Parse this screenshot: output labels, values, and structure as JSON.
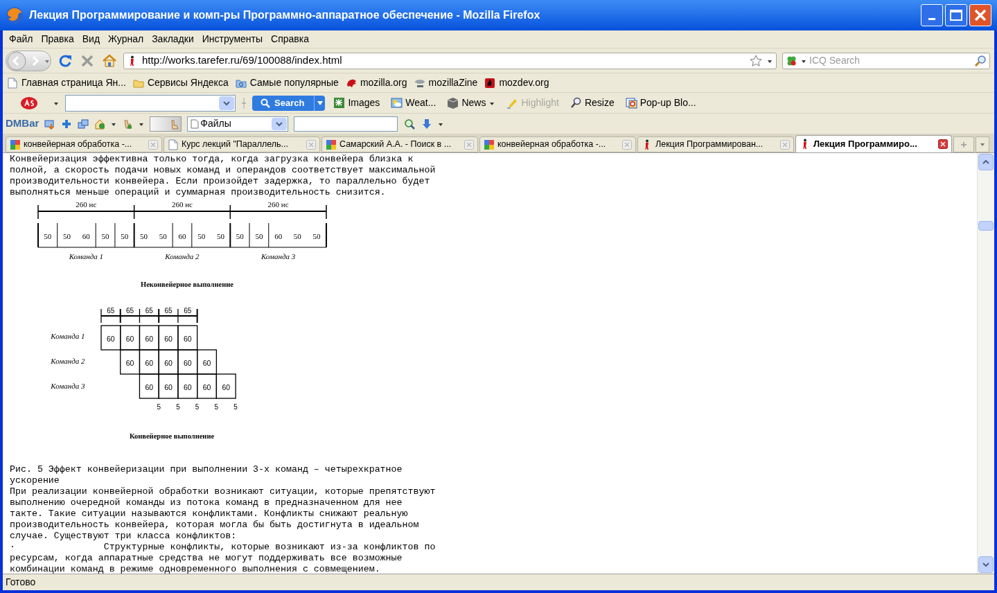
{
  "window": {
    "title": "Лекция Программирование и комп-ры Программно-аппаратное обеспечение - Mozilla Firefox"
  },
  "menu": [
    "Файл",
    "Правка",
    "Вид",
    "Журнал",
    "Закладки",
    "Инструменты",
    "Справка"
  ],
  "navigation": {
    "url": "http://works.tarefer.ru/69/100088/index.html",
    "search_placeholder": "ICQ Search"
  },
  "bookmarks": [
    "Главная страница Ян...",
    "Сервисы Яндекса",
    "Самые популярные",
    "mozilla.org",
    "mozillaZine",
    "mozdev.org"
  ],
  "ask_toolbar": {
    "search_button": "Search",
    "items": [
      {
        "label": "Images",
        "disabled": false,
        "dropdown": false
      },
      {
        "label": "Weat...",
        "disabled": false,
        "dropdown": false
      },
      {
        "label": "News",
        "disabled": false,
        "dropdown": true
      },
      {
        "label": "Highlight",
        "disabled": true,
        "dropdown": false
      },
      {
        "label": "Resize",
        "disabled": false,
        "dropdown": false
      },
      {
        "label": "Pop-up Blo...",
        "disabled": false,
        "dropdown": false
      }
    ]
  },
  "dm_bar": {
    "label": "DMBar",
    "folder": "Файлы"
  },
  "tabs": [
    {
      "label": "конвейерная обработка -...",
      "selected": false
    },
    {
      "label": "Курс лекций \"Параллель...",
      "selected": false
    },
    {
      "label": "Самарский А.А. - Поиск в ...",
      "selected": false
    },
    {
      "label": "конвейерная обработка -...",
      "selected": false
    },
    {
      "label": "Лекция Программирован...",
      "selected": false
    },
    {
      "label": "Лекция Программиро...",
      "selected": true
    }
  ],
  "content": {
    "intro": [
      "Конвейеризация эффективна только тогда, когда загрузка конвейера близка к",
      "полной, а скорость подачи новых команд и операндов соответствует максимальной",
      "производительности конвейера. Если произойдет задержка, то параллельно будет",
      "выполняться меньше операций и суммарная производительность снизится."
    ],
    "sequential": {
      "spans": [
        "260 нс",
        "260 нс",
        "260 нс"
      ],
      "commands": [
        {
          "label": "Команда 1",
          "groups": [
            [
              "50"
            ],
            [
              "50",
              "60"
            ],
            [
              "50"
            ],
            [
              "50"
            ]
          ]
        },
        {
          "label": "Команда 2",
          "groups": [
            [
              "50",
              "50"
            ],
            [
              "60"
            ],
            [
              "50",
              "50"
            ]
          ]
        },
        {
          "label": "Команда 3",
          "groups": [
            [
              "50"
            ],
            [
              "50"
            ],
            [
              "60",
              "50",
              "50"
            ]
          ]
        }
      ],
      "caption": "Неконвейерное выполнение"
    },
    "pipelined": {
      "durations": [
        "65",
        "65",
        "65",
        "65",
        "65"
      ],
      "rows": [
        {
          "label": "Команда 1",
          "values": [
            "60",
            "60",
            "60",
            "60",
            "60"
          ]
        },
        {
          "label": "Команда 2",
          "values": [
            "60",
            "60",
            "60",
            "60",
            "60"
          ]
        },
        {
          "label": "Команда 3",
          "values": [
            "60",
            "60",
            "60",
            "60",
            "60"
          ]
        }
      ],
      "marks": [
        "5",
        "5",
        "5",
        "5",
        "5"
      ],
      "caption": "Конвейерное выполнение"
    },
    "caption": [
      "Рис. 5 Эффект конвейеризации при выполнении 3-х команд – четырехкратное",
      "ускорение"
    ],
    "paragraph": [
      "При реализации конвейерной обработки возникают ситуации, которые препятствуют",
      "выполнению очередной команды из потока команд в предназначенном для нее",
      "такте. Такие ситуации называются конфликтами. Конфликты снижают реальную",
      "производительность конвейера, которая могла бы быть достигнута в идеальном",
      "случае. Существуют три класса конфликтов:"
    ],
    "bullet": [
      "·                Структурные конфликты, которые возникают из-за конфликтов по",
      "ресурсам, когда аппаратные средства не могут поддерживать все возможные",
      "комбинации команд в режиме одновременного выполнения с совмещением."
    ]
  },
  "status_bar": "Готово"
}
